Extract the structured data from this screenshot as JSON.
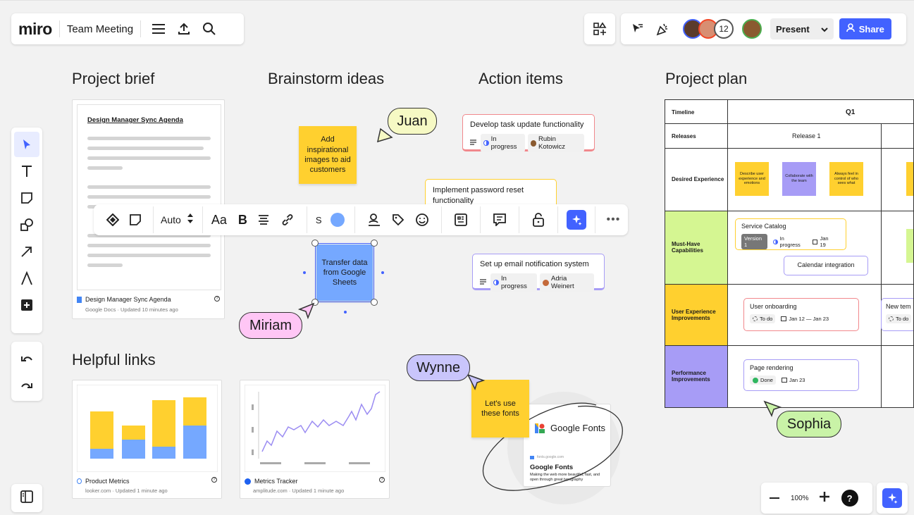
{
  "topbar": {
    "logo": "miro",
    "board_title": "Team Meeting",
    "collaborator_count": "12",
    "present_label": "Present",
    "share_label": "Share"
  },
  "sections": {
    "project_brief": "Project brief",
    "brainstorm": "Brainstorm ideas",
    "action_items": "Action items",
    "project_plan": "Project plan",
    "helpful_links": "Helpful links"
  },
  "brief_doc": {
    "heading": "Design Manager Sync Agenda",
    "footer_title": "Design Manager Sync Agenda",
    "footer_meta": "Google Docs · Updated 10 minutes ago"
  },
  "stickies": {
    "inspiration": "Add inspirational images to aid customers",
    "transfer": "Transfer data from Google Sheets",
    "fonts": "Let's use these fonts"
  },
  "cursors": {
    "juan": "Juan",
    "miriam": "Miriam",
    "wynne": "Wynne",
    "sophia": "Sophia"
  },
  "tasks": {
    "task1": {
      "title": "Develop task update functionality",
      "status": "In progress",
      "assignee": "Rubin Kotowicz"
    },
    "task2": {
      "title": "Implement password reset functionality"
    },
    "task3": {
      "title": "Set up email notification system",
      "status": "In progress",
      "assignee": "Adria Weinert"
    }
  },
  "toolbar": {
    "auto": "Auto",
    "font": "Aa",
    "bold": "B",
    "size": "S"
  },
  "plan": {
    "timeline": "Timeline",
    "q1": "Q1",
    "releases": "Releases",
    "release1": "Release 1",
    "desired": "Desired Experience",
    "must_have": "Must-Have Capabilities",
    "ux_improve": "User Experience Improvements",
    "perf_improve": "Performance Improvements",
    "sticky1": "Describe user experience and emotions",
    "sticky2": "Collaborate with the team",
    "sticky3": "Always feel in control of who sees what",
    "service_catalog": "Service Catalog",
    "version": "Version 1",
    "sc_status": "In progress",
    "sc_date": "Jan 19",
    "calendar": "Calendar integration",
    "onboarding": "User onboarding",
    "ob_status": "To do",
    "ob_date": "Jan 12 — Jan 23",
    "new_tem": "New tem",
    "new_todo": "To do",
    "rendering": "Page rendering",
    "pr_status": "Done",
    "pr_date": "Jan 23"
  },
  "links": {
    "product_metrics": "Product Metrics",
    "pm_meta": "looker.com · Updated 1 minute ago",
    "metrics_tracker": "Metrics Tracker",
    "mt_meta": "amplitude.com · Updated 1 minute ago"
  },
  "google_fonts": {
    "logo_text": "Google Fonts",
    "url": "fonts.google.com",
    "title": "Google Fonts",
    "desc": "Making the web more beautiful, fast, and open through great typography"
  },
  "zoom": {
    "level": "100%",
    "help": "?"
  },
  "colors": {
    "accent": "#4262ff",
    "yellow": "#ffd02f",
    "blue_sticky": "#75a8ff",
    "green": "#d5f692",
    "purple": "#a79cf6",
    "pink_cursor": "#ffc6f5",
    "yellow_cursor": "#f6f9c4",
    "purple_cursor": "#c9c5fb",
    "green_cursor": "#c9f3a7"
  }
}
